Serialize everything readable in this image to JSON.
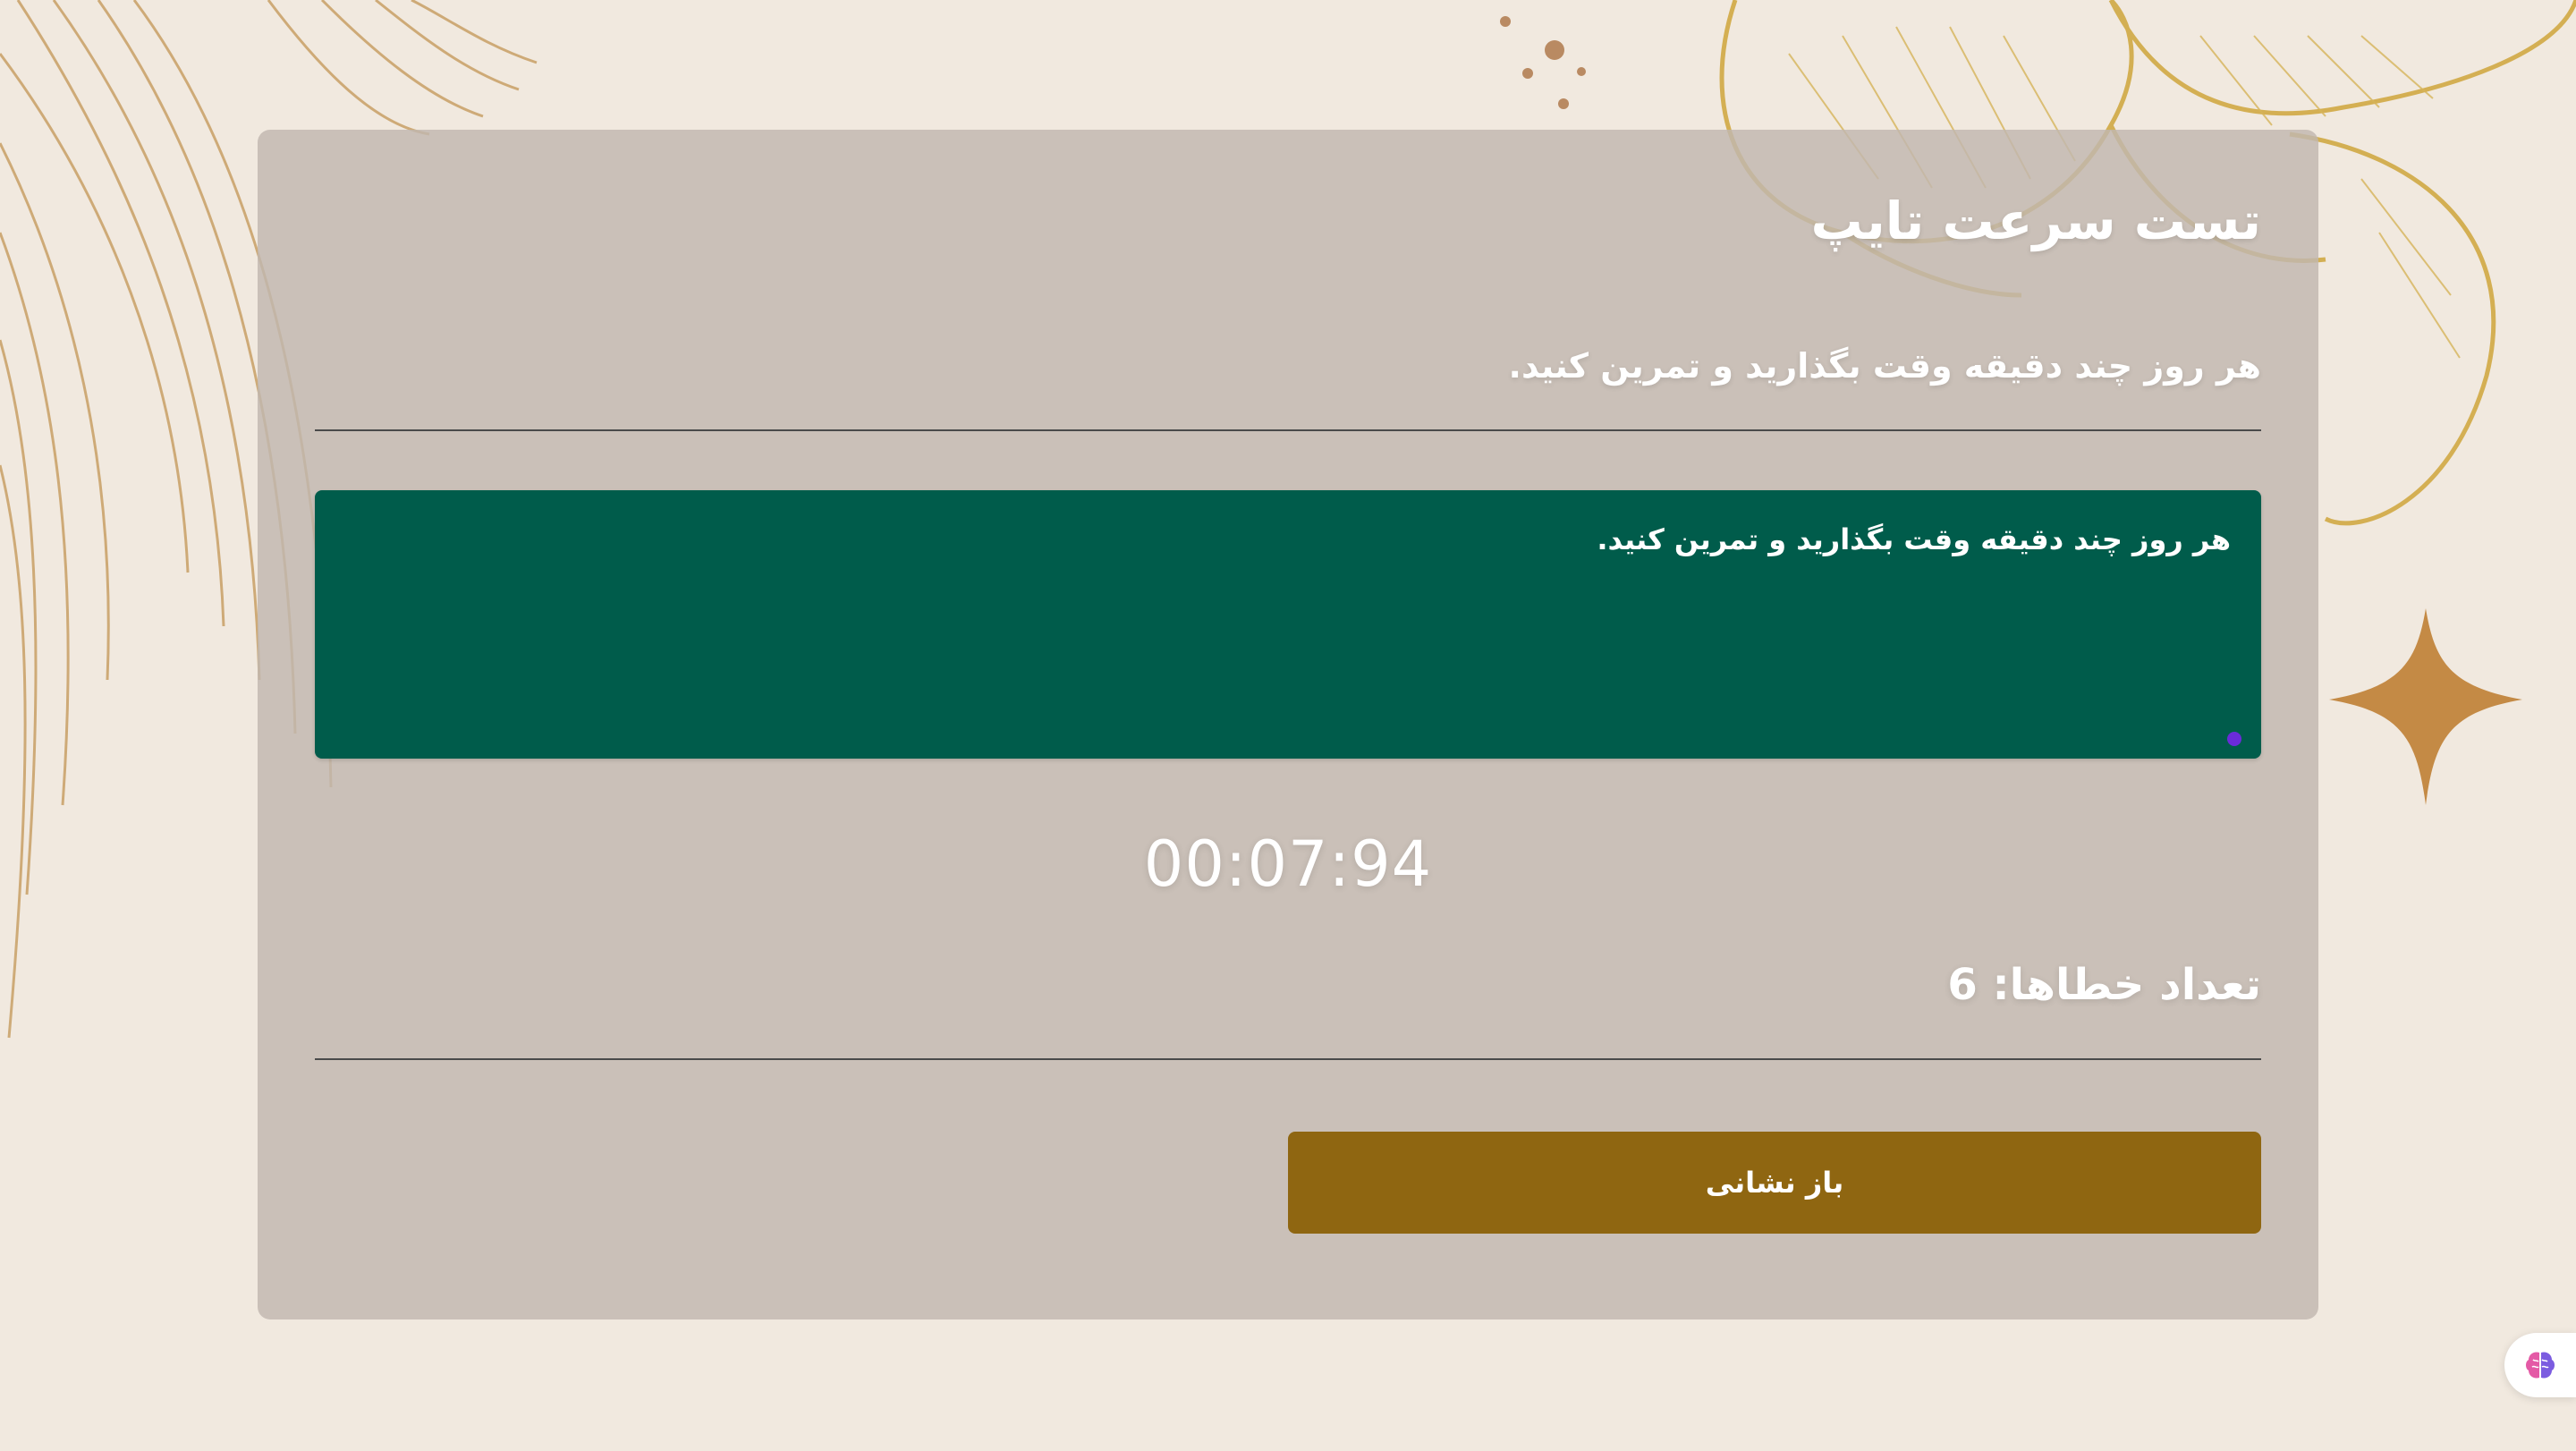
{
  "page": {
    "title": "تست سرعت تایپ",
    "sample_text": "هر روز چند دقیقه وقت بگذارید و تمرین کنید.",
    "typed_text": "هر روز چند دقیقه وقت بگذارید و تمرین کنید.",
    "timer": "00:07:94",
    "errors_label": "تعداد خطاها: 6",
    "reset_label": "باز نشانی"
  },
  "colors": {
    "background": "#f1e9df",
    "card": "#c1b7b0",
    "typing_area": "#005c4b",
    "reset_button": "#8f6611",
    "accent_gold": "#c9a34a"
  },
  "icons": {
    "floating": "brain-icon"
  }
}
